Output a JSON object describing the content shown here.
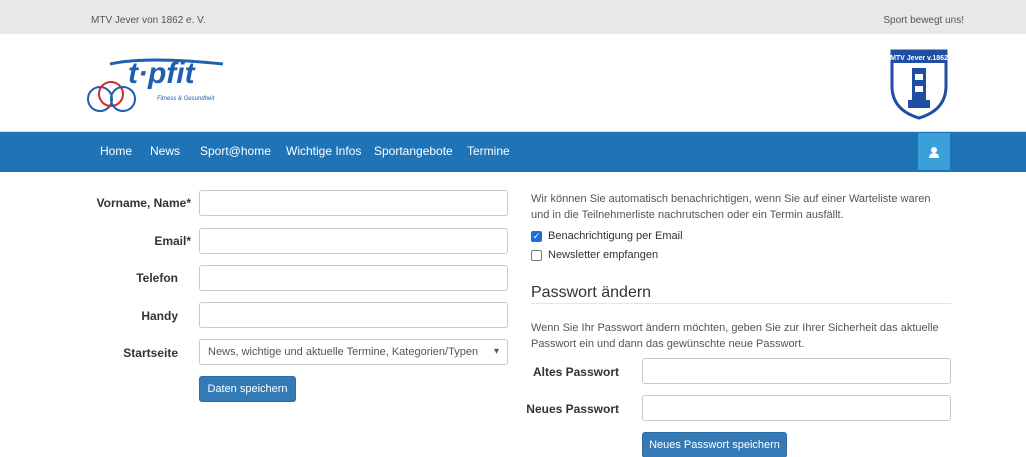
{
  "topbar": {
    "club_name": "MTV Jever von 1862 e. V.",
    "slogan": "Sport bewegt uns!"
  },
  "header": {
    "logo_text": "t·pfit",
    "logo_tagline": "Fitness & Gesundheit",
    "badge_text": "MTV Jever v.1862"
  },
  "nav": {
    "items": [
      "Home",
      "News",
      "Sport@home",
      "Wichtige Infos",
      "Sportangebote",
      "Termine"
    ]
  },
  "form": {
    "name_label": "Vorname, Name*",
    "email_label": "Email*",
    "phone_label": "Telefon",
    "mobile_label": "Handy",
    "start_label": "Startseite",
    "start_value": "News, wichtige und aktuelle Termine, Kategorien/Typen",
    "save_button": "Daten speichern"
  },
  "notifications": {
    "text": "Wir können Sie automatisch benachrichtigen, wenn Sie auf einer Warteliste waren und in die Teilnehmerliste nachrutschen oder ein Termin ausfällt.",
    "email_label": "Benachrichtigung per Email",
    "newsletter_label": "Newsletter empfangen",
    "email_checked": true,
    "newsletter_checked": false
  },
  "password": {
    "title": "Passwort ändern",
    "text": "Wenn Sie Ihr Passwort ändern möchten, geben Sie zur Ihrer Sicherheit das aktuelle Passwort ein und dann das gewünschte neue Passwort.",
    "old_label": "Altes Passwort",
    "new_label": "Neues Passwort",
    "save_button": "Neues Passwort speichern"
  },
  "colors": {
    "nav": "#1f74b8",
    "button": "#337ab7",
    "user_button": "#39a0d8"
  }
}
